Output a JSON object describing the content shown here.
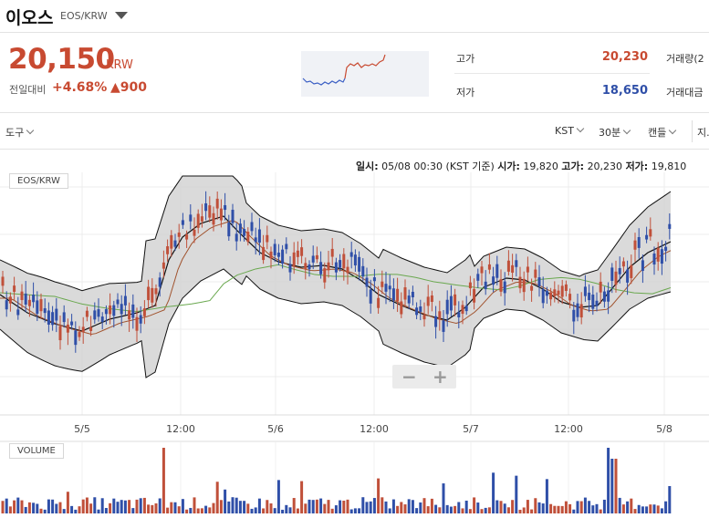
{
  "header": {
    "coin_name": "이오스",
    "pair": "EOS/KRW"
  },
  "price": {
    "current": "20,150",
    "unit": "KRW",
    "prev_label": "전일대비",
    "change_pct": "+4.68%",
    "change_abs": "▲900"
  },
  "stats": {
    "high_label": "고가",
    "high_value": "20,230",
    "low_label": "저가",
    "low_value": "18,650",
    "volume_label": "거래량(2",
    "amount_label": "거래대금"
  },
  "toolbar": {
    "tools_label": "도구",
    "timezone_label": "KST",
    "interval_label": "30분",
    "chart_type_label": "캔들",
    "indicator_label": "지."
  },
  "info": {
    "date_label": "일시:",
    "date_value": "05/08 00:30 (KST 기준)",
    "open_label": "시가:",
    "open_value": "19,820",
    "high_label": "고가:",
    "high_value": "20,230",
    "low_label": "저가:",
    "low_value": "19,810"
  },
  "chart": {
    "main_tag": "EOS/KRW",
    "volume_tag": "VOLUME",
    "x_ticks": [
      "5/5",
      "12:00",
      "5/6",
      "12:00",
      "5/7",
      "12:00",
      "5/8"
    ],
    "colors": {
      "up": "#c0503a",
      "down": "#2f4fa8",
      "band_fill": "#d3d3d3",
      "ma_short": "#a0522d",
      "ma_long": "#6aa84f"
    }
  },
  "chart_data": {
    "type": "line",
    "x": [
      "5/5",
      "12:00",
      "5/6",
      "12:00",
      "5/7",
      "12:00",
      "5/8"
    ],
    "series": [
      {
        "values": [
          18900,
          19700,
          19500,
          19100,
          19400,
          19200,
          20150
        ]
      }
    ]
  },
  "zoom": {
    "minus": "−",
    "plus": "+"
  }
}
